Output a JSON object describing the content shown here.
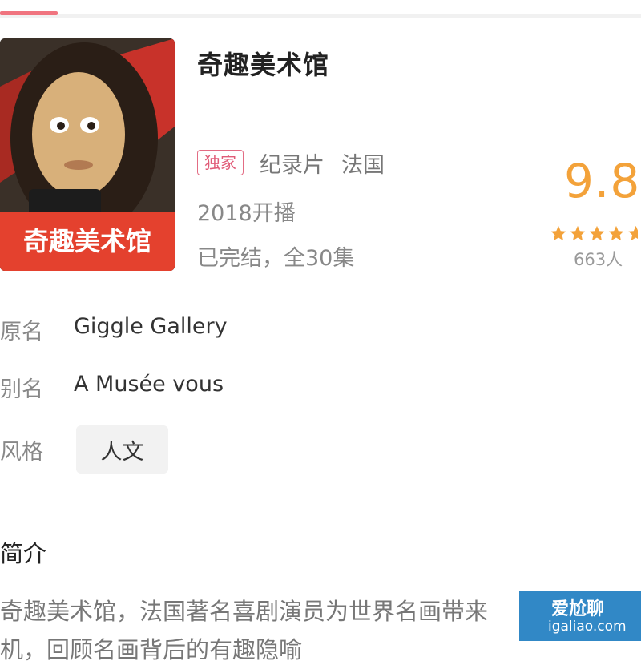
{
  "show": {
    "title": "奇趣美术馆",
    "poster_caption": "奇趣美术馆",
    "tag": "独家",
    "category": "纪录片",
    "region": "法国",
    "premiere": "2018开播",
    "status": "已完结，全30集"
  },
  "rating": {
    "score": "9.8",
    "stars": 5,
    "votes": "663人",
    "color": "#f3a23a"
  },
  "details": {
    "original_name_label": "原名",
    "original_name": "Giggle Gallery",
    "alias_label": "别名",
    "alias": "A Musée vous",
    "genre_label": "风格",
    "genre": "人文"
  },
  "intro": {
    "heading": "简介",
    "text": "奇趣美术馆，法国著名喜剧演员为世界名画带来",
    "text_line2": "机，回顾名画背后的有趣隐喻"
  },
  "watermark": {
    "brand": "爱尬聊",
    "url": "igaliao.com"
  },
  "colors": {
    "accent": "#f0747f",
    "tag": "#e05b77"
  }
}
